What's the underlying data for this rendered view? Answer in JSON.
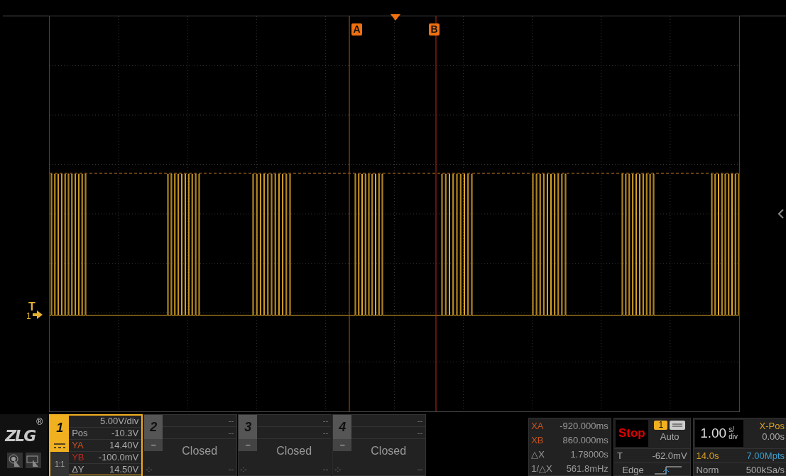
{
  "screen": {
    "cursors": [
      {
        "label": "A"
      },
      {
        "label": "B"
      }
    ],
    "trigger_marker": {
      "label": "T",
      "channel": "1"
    }
  },
  "logo": {
    "text": "ZLG",
    "mark": "®"
  },
  "channels": [
    {
      "kind": "open",
      "number": "1",
      "selected": true,
      "scale": "5.00V/div",
      "pos_label": "Pos",
      "pos": "-10.3V",
      "ya_label": "YA",
      "ya": "14.40V",
      "yb_label": "YB",
      "yb": "-100.0mV",
      "probe": "1:1",
      "dy_label": "ΔY",
      "dy": "14.50V"
    },
    {
      "kind": "closed",
      "number": "2",
      "selected": false,
      "row_1": "--",
      "row_2": "--",
      "minus": "−",
      "status": "Closed",
      "corner": "-:-",
      "row_3": "--"
    },
    {
      "kind": "closed",
      "number": "3",
      "selected": false,
      "row_1": "--",
      "row_2": "--",
      "minus": "−",
      "status": "Closed",
      "corner": "-:-",
      "row_3": "--"
    },
    {
      "kind": "closed",
      "number": "4",
      "selected": false,
      "row_1": "--",
      "row_2": "--",
      "minus": "−",
      "status": "Closed",
      "corner": "-:-",
      "row_3": "--"
    }
  ],
  "cursor_readouts": [
    {
      "label": "XA",
      "value": "-920.000ms",
      "color": "#c8501e"
    },
    {
      "label": "XB",
      "value": "860.000ms",
      "color": "#c8501e"
    },
    {
      "label": "△X",
      "value": "1.78000s",
      "color": "#9a9a9a"
    },
    {
      "label": "1/△X",
      "value": "561.8mHz",
      "color": "#9a9a9a"
    }
  ],
  "trigger": {
    "state": "Stop",
    "source": "1",
    "mode": "Auto",
    "level_label": "T",
    "trigger_level": "-62.0mV",
    "type": "Edge"
  },
  "timebase": {
    "scale": "1.00",
    "unit_top": "s/",
    "unit_bottom": "div",
    "xpos_label": "X-Pos",
    "xpos": "0.00s",
    "duration": "14.0s",
    "depth": "7.00Mpts",
    "acq_mode": "Norm",
    "sample_rate": "500kSa/s"
  }
}
